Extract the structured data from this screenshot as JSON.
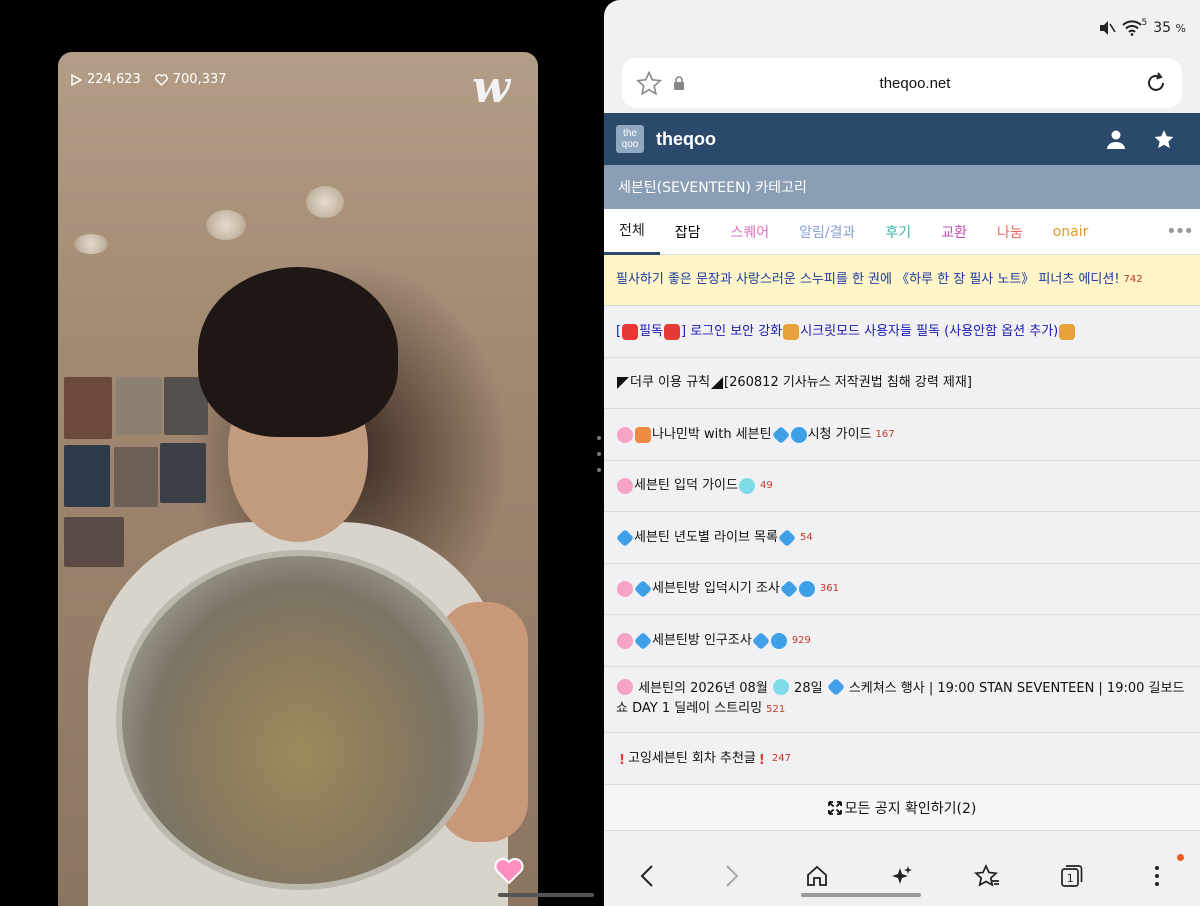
{
  "video": {
    "views": "224,623",
    "likes": "700,337",
    "app_logo": "w"
  },
  "status_bar": {
    "battery": "35",
    "battery_unit": "%",
    "signal_label": "5"
  },
  "browser": {
    "url": "theqoo.net",
    "nav_count": "1"
  },
  "site": {
    "logo_top": "the",
    "logo_bottom": "qoo",
    "name": "theqoo",
    "category": "세븐틴(SEVENTEEN) 카테고리",
    "tabs": [
      {
        "label": "전체",
        "color": "#222222"
      },
      {
        "label": "잡담",
        "color": "#222222"
      },
      {
        "label": "스퀘어",
        "color": "#e06fc0"
      },
      {
        "label": "알림/결과",
        "color": "#8aa0d6"
      },
      {
        "label": "후기",
        "color": "#3bb3a8"
      },
      {
        "label": "교환",
        "color": "#c94fb8"
      },
      {
        "label": "나눔",
        "color": "#ef6a5f"
      },
      {
        "label": "onair",
        "color": "#e39a22"
      }
    ],
    "more": "•••"
  },
  "posts": [
    {
      "text": "필사하기 좋은 문장과 사랑스러운 스누피를 한 권에 《하루 한 장 필사 노트》 피너츠 에디션!",
      "count": "742"
    },
    {
      "prefix": "[",
      "tag": "필독",
      "suffix": "] 로그인 보안 강화",
      "text": "시크릿모드 사용자들 필독 (사용안함 옵션 추가)"
    },
    {
      "text": "더쿠 이용 규칙",
      "text2": "[260812 기사뉴스 저작권법 침해 강력 제재]"
    },
    {
      "text": "나나민박 with 세븐틴",
      "text2": " 시청 가이드",
      "count": "167"
    },
    {
      "text": " 세븐틴 입덕 가이드 ",
      "count": "49"
    },
    {
      "text": "세븐틴 년도별 라이브 목록",
      "count": "54"
    },
    {
      "text": "세븐틴방 입덕시기 조사",
      "count": "361"
    },
    {
      "text": "세븐틴방 인구조사",
      "count": "929"
    },
    {
      "text": " 세븐틴의 2026년 08월 ",
      "text2": " 28일 ",
      "text3": " 스케쳐스 행사 | 19:00 STAN SEVENTEEN | 19:00 길보드쇼 DAY 1 딜레이 스트리밍",
      "count": "521"
    },
    {
      "text": " 고잉세븐틴 회차 추천글",
      "count": "247"
    }
  ],
  "all_notices": "모든 공지 확인하기(2)",
  "colors": {
    "header": "#2b4a6b",
    "category_bar": "#8a9eb5",
    "highlight_bg": "#fff5c9",
    "count": "#c0392b"
  }
}
